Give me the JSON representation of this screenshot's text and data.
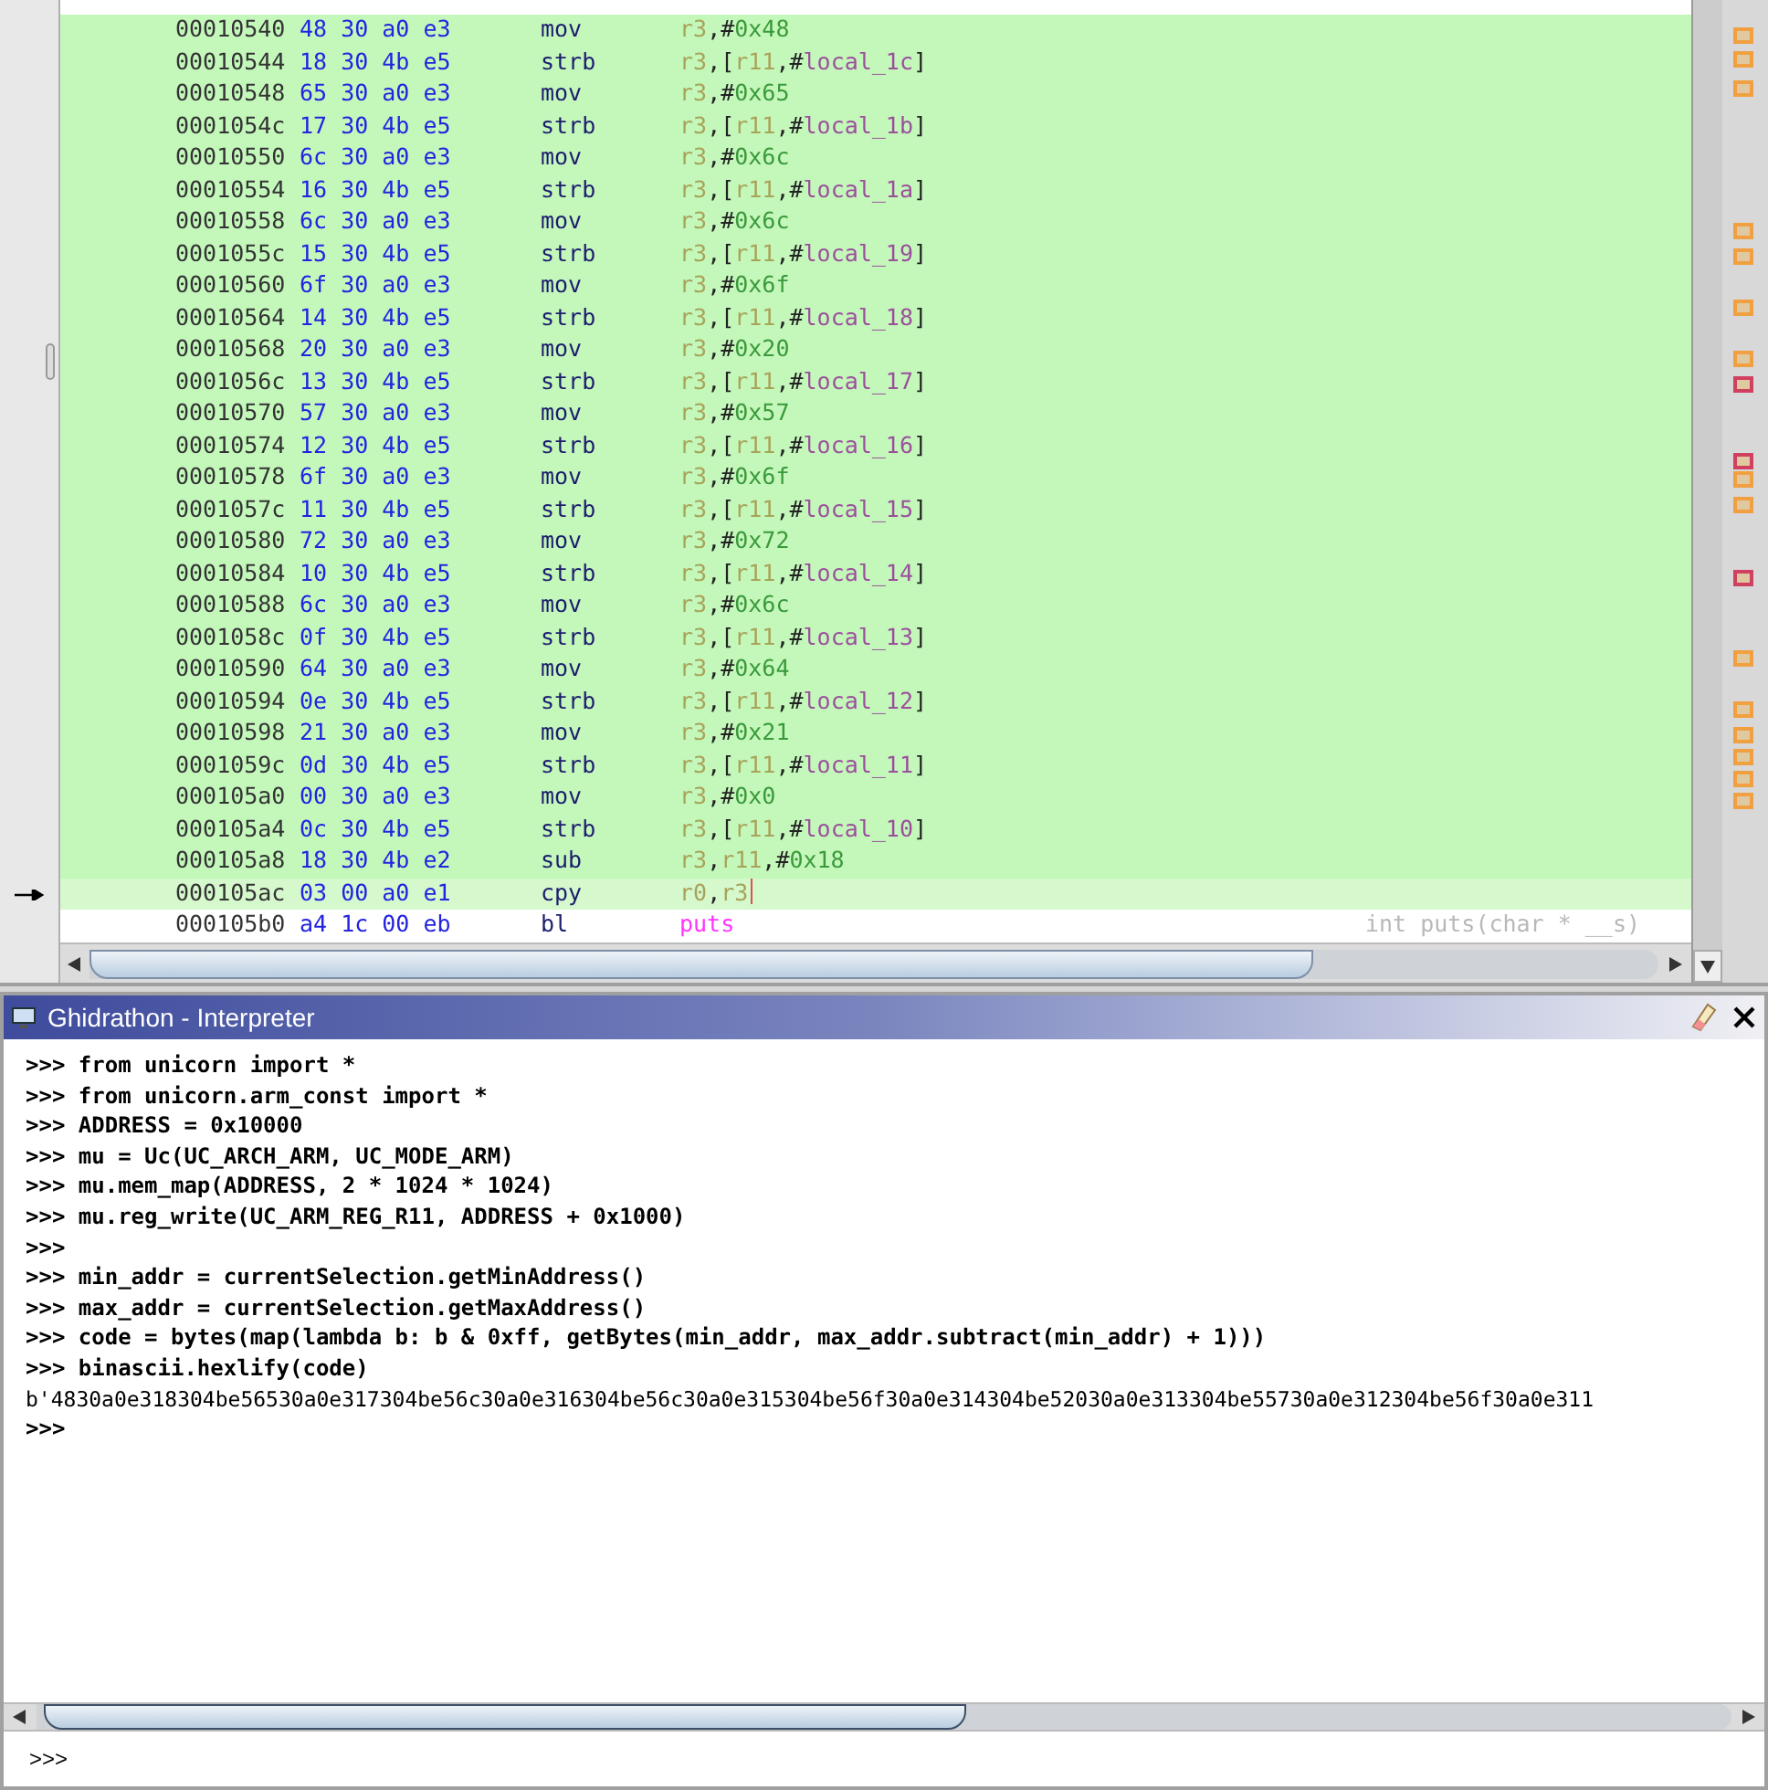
{
  "listing": {
    "rows": [
      {
        "address": "00010540",
        "bytes": "48 30 a0 e3",
        "mnemonic": "mov",
        "operands": [
          {
            "text": "r3",
            "kind": "register"
          },
          {
            "text": ",#",
            "kind": "punct"
          },
          {
            "text": "0x48",
            "kind": "scalar"
          }
        ],
        "in_selection": true,
        "cursor": false
      },
      {
        "address": "00010544",
        "bytes": "18 30 4b e5",
        "mnemonic": "strb",
        "operands": [
          {
            "text": "r3",
            "kind": "register"
          },
          {
            "text": ",[",
            "kind": "punct"
          },
          {
            "text": "r11",
            "kind": "register"
          },
          {
            "text": ",#",
            "kind": "punct"
          },
          {
            "text": "local_1c",
            "kind": "variable"
          },
          {
            "text": "]",
            "kind": "punct"
          }
        ],
        "in_selection": true,
        "cursor": false
      },
      {
        "address": "00010548",
        "bytes": "65 30 a0 e3",
        "mnemonic": "mov",
        "operands": [
          {
            "text": "r3",
            "kind": "register"
          },
          {
            "text": ",#",
            "kind": "punct"
          },
          {
            "text": "0x65",
            "kind": "scalar"
          }
        ],
        "in_selection": true,
        "cursor": false
      },
      {
        "address": "0001054c",
        "bytes": "17 30 4b e5",
        "mnemonic": "strb",
        "operands": [
          {
            "text": "r3",
            "kind": "register"
          },
          {
            "text": ",[",
            "kind": "punct"
          },
          {
            "text": "r11",
            "kind": "register"
          },
          {
            "text": ",#",
            "kind": "punct"
          },
          {
            "text": "local_1b",
            "kind": "variable"
          },
          {
            "text": "]",
            "kind": "punct"
          }
        ],
        "in_selection": true,
        "cursor": false
      },
      {
        "address": "00010550",
        "bytes": "6c 30 a0 e3",
        "mnemonic": "mov",
        "operands": [
          {
            "text": "r3",
            "kind": "register"
          },
          {
            "text": ",#",
            "kind": "punct"
          },
          {
            "text": "0x6c",
            "kind": "scalar"
          }
        ],
        "in_selection": true,
        "cursor": false
      },
      {
        "address": "00010554",
        "bytes": "16 30 4b e5",
        "mnemonic": "strb",
        "operands": [
          {
            "text": "r3",
            "kind": "register"
          },
          {
            "text": ",[",
            "kind": "punct"
          },
          {
            "text": "r11",
            "kind": "register"
          },
          {
            "text": ",#",
            "kind": "punct"
          },
          {
            "text": "local_1a",
            "kind": "variable"
          },
          {
            "text": "]",
            "kind": "punct"
          }
        ],
        "in_selection": true,
        "cursor": false
      },
      {
        "address": "00010558",
        "bytes": "6c 30 a0 e3",
        "mnemonic": "mov",
        "operands": [
          {
            "text": "r3",
            "kind": "register"
          },
          {
            "text": ",#",
            "kind": "punct"
          },
          {
            "text": "0x6c",
            "kind": "scalar"
          }
        ],
        "in_selection": true,
        "cursor": false
      },
      {
        "address": "0001055c",
        "bytes": "15 30 4b e5",
        "mnemonic": "strb",
        "operands": [
          {
            "text": "r3",
            "kind": "register"
          },
          {
            "text": ",[",
            "kind": "punct"
          },
          {
            "text": "r11",
            "kind": "register"
          },
          {
            "text": ",#",
            "kind": "punct"
          },
          {
            "text": "local_19",
            "kind": "variable"
          },
          {
            "text": "]",
            "kind": "punct"
          }
        ],
        "in_selection": true,
        "cursor": false
      },
      {
        "address": "00010560",
        "bytes": "6f 30 a0 e3",
        "mnemonic": "mov",
        "operands": [
          {
            "text": "r3",
            "kind": "register"
          },
          {
            "text": ",#",
            "kind": "punct"
          },
          {
            "text": "0x6f",
            "kind": "scalar"
          }
        ],
        "in_selection": true,
        "cursor": false
      },
      {
        "address": "00010564",
        "bytes": "14 30 4b e5",
        "mnemonic": "strb",
        "operands": [
          {
            "text": "r3",
            "kind": "register"
          },
          {
            "text": ",[",
            "kind": "punct"
          },
          {
            "text": "r11",
            "kind": "register"
          },
          {
            "text": ",#",
            "kind": "punct"
          },
          {
            "text": "local_18",
            "kind": "variable"
          },
          {
            "text": "]",
            "kind": "punct"
          }
        ],
        "in_selection": true,
        "cursor": false
      },
      {
        "address": "00010568",
        "bytes": "20 30 a0 e3",
        "mnemonic": "mov",
        "operands": [
          {
            "text": "r3",
            "kind": "register"
          },
          {
            "text": ",#",
            "kind": "punct"
          },
          {
            "text": "0x20",
            "kind": "scalar"
          }
        ],
        "in_selection": true,
        "cursor": false
      },
      {
        "address": "0001056c",
        "bytes": "13 30 4b e5",
        "mnemonic": "strb",
        "operands": [
          {
            "text": "r3",
            "kind": "register"
          },
          {
            "text": ",[",
            "kind": "punct"
          },
          {
            "text": "r11",
            "kind": "register"
          },
          {
            "text": ",#",
            "kind": "punct"
          },
          {
            "text": "local_17",
            "kind": "variable"
          },
          {
            "text": "]",
            "kind": "punct"
          }
        ],
        "in_selection": true,
        "cursor": false
      },
      {
        "address": "00010570",
        "bytes": "57 30 a0 e3",
        "mnemonic": "mov",
        "operands": [
          {
            "text": "r3",
            "kind": "register"
          },
          {
            "text": ",#",
            "kind": "punct"
          },
          {
            "text": "0x57",
            "kind": "scalar"
          }
        ],
        "in_selection": true,
        "cursor": false
      },
      {
        "address": "00010574",
        "bytes": "12 30 4b e5",
        "mnemonic": "strb",
        "operands": [
          {
            "text": "r3",
            "kind": "register"
          },
          {
            "text": ",[",
            "kind": "punct"
          },
          {
            "text": "r11",
            "kind": "register"
          },
          {
            "text": ",#",
            "kind": "punct"
          },
          {
            "text": "local_16",
            "kind": "variable"
          },
          {
            "text": "]",
            "kind": "punct"
          }
        ],
        "in_selection": true,
        "cursor": false
      },
      {
        "address": "00010578",
        "bytes": "6f 30 a0 e3",
        "mnemonic": "mov",
        "operands": [
          {
            "text": "r3",
            "kind": "register"
          },
          {
            "text": ",#",
            "kind": "punct"
          },
          {
            "text": "0x6f",
            "kind": "scalar"
          }
        ],
        "in_selection": true,
        "cursor": false
      },
      {
        "address": "0001057c",
        "bytes": "11 30 4b e5",
        "mnemonic": "strb",
        "operands": [
          {
            "text": "r3",
            "kind": "register"
          },
          {
            "text": ",[",
            "kind": "punct"
          },
          {
            "text": "r11",
            "kind": "register"
          },
          {
            "text": ",#",
            "kind": "punct"
          },
          {
            "text": "local_15",
            "kind": "variable"
          },
          {
            "text": "]",
            "kind": "punct"
          }
        ],
        "in_selection": true,
        "cursor": false
      },
      {
        "address": "00010580",
        "bytes": "72 30 a0 e3",
        "mnemonic": "mov",
        "operands": [
          {
            "text": "r3",
            "kind": "register"
          },
          {
            "text": ",#",
            "kind": "punct"
          },
          {
            "text": "0x72",
            "kind": "scalar"
          }
        ],
        "in_selection": true,
        "cursor": false
      },
      {
        "address": "00010584",
        "bytes": "10 30 4b e5",
        "mnemonic": "strb",
        "operands": [
          {
            "text": "r3",
            "kind": "register"
          },
          {
            "text": ",[",
            "kind": "punct"
          },
          {
            "text": "r11",
            "kind": "register"
          },
          {
            "text": ",#",
            "kind": "punct"
          },
          {
            "text": "local_14",
            "kind": "variable"
          },
          {
            "text": "]",
            "kind": "punct"
          }
        ],
        "in_selection": true,
        "cursor": false
      },
      {
        "address": "00010588",
        "bytes": "6c 30 a0 e3",
        "mnemonic": "mov",
        "operands": [
          {
            "text": "r3",
            "kind": "register"
          },
          {
            "text": ",#",
            "kind": "punct"
          },
          {
            "text": "0x6c",
            "kind": "scalar"
          }
        ],
        "in_selection": true,
        "cursor": false
      },
      {
        "address": "0001058c",
        "bytes": "0f 30 4b e5",
        "mnemonic": "strb",
        "operands": [
          {
            "text": "r3",
            "kind": "register"
          },
          {
            "text": ",[",
            "kind": "punct"
          },
          {
            "text": "r11",
            "kind": "register"
          },
          {
            "text": ",#",
            "kind": "punct"
          },
          {
            "text": "local_13",
            "kind": "variable"
          },
          {
            "text": "]",
            "kind": "punct"
          }
        ],
        "in_selection": true,
        "cursor": false
      },
      {
        "address": "00010590",
        "bytes": "64 30 a0 e3",
        "mnemonic": "mov",
        "operands": [
          {
            "text": "r3",
            "kind": "register"
          },
          {
            "text": ",#",
            "kind": "punct"
          },
          {
            "text": "0x64",
            "kind": "scalar"
          }
        ],
        "in_selection": true,
        "cursor": false
      },
      {
        "address": "00010594",
        "bytes": "0e 30 4b e5",
        "mnemonic": "strb",
        "operands": [
          {
            "text": "r3",
            "kind": "register"
          },
          {
            "text": ",[",
            "kind": "punct"
          },
          {
            "text": "r11",
            "kind": "register"
          },
          {
            "text": ",#",
            "kind": "punct"
          },
          {
            "text": "local_12",
            "kind": "variable"
          },
          {
            "text": "]",
            "kind": "punct"
          }
        ],
        "in_selection": true,
        "cursor": false
      },
      {
        "address": "00010598",
        "bytes": "21 30 a0 e3",
        "mnemonic": "mov",
        "operands": [
          {
            "text": "r3",
            "kind": "register"
          },
          {
            "text": ",#",
            "kind": "punct"
          },
          {
            "text": "0x21",
            "kind": "scalar"
          }
        ],
        "in_selection": true,
        "cursor": false
      },
      {
        "address": "0001059c",
        "bytes": "0d 30 4b e5",
        "mnemonic": "strb",
        "operands": [
          {
            "text": "r3",
            "kind": "register"
          },
          {
            "text": ",[",
            "kind": "punct"
          },
          {
            "text": "r11",
            "kind": "register"
          },
          {
            "text": ",#",
            "kind": "punct"
          },
          {
            "text": "local_11",
            "kind": "variable"
          },
          {
            "text": "]",
            "kind": "punct"
          }
        ],
        "in_selection": true,
        "cursor": false
      },
      {
        "address": "000105a0",
        "bytes": "00 30 a0 e3",
        "mnemonic": "mov",
        "operands": [
          {
            "text": "r3",
            "kind": "register"
          },
          {
            "text": ",#",
            "kind": "punct"
          },
          {
            "text": "0x0",
            "kind": "scalar"
          }
        ],
        "in_selection": true,
        "cursor": false
      },
      {
        "address": "000105a4",
        "bytes": "0c 30 4b e5",
        "mnemonic": "strb",
        "operands": [
          {
            "text": "r3",
            "kind": "register"
          },
          {
            "text": ",[",
            "kind": "punct"
          },
          {
            "text": "r11",
            "kind": "register"
          },
          {
            "text": ",#",
            "kind": "punct"
          },
          {
            "text": "local_10",
            "kind": "variable"
          },
          {
            "text": "]",
            "kind": "punct"
          }
        ],
        "in_selection": true,
        "cursor": false
      },
      {
        "address": "000105a8",
        "bytes": "18 30 4b e2",
        "mnemonic": "sub",
        "operands": [
          {
            "text": "r3",
            "kind": "register"
          },
          {
            "text": ",",
            "kind": "punct"
          },
          {
            "text": "r11",
            "kind": "register"
          },
          {
            "text": ",#",
            "kind": "punct"
          },
          {
            "text": "0x18",
            "kind": "scalar"
          }
        ],
        "in_selection": true,
        "cursor": false
      },
      {
        "address": "000105ac",
        "bytes": "03 00 a0 e1",
        "mnemonic": "cpy",
        "operands": [
          {
            "text": "r0",
            "kind": "register"
          },
          {
            "text": ",",
            "kind": "punct"
          },
          {
            "text": "r3",
            "kind": "register"
          }
        ],
        "in_selection": true,
        "cursor": true
      },
      {
        "address": "000105b0",
        "bytes": "a4 1c 00 eb",
        "mnemonic": "bl",
        "operands": [
          {
            "text": "puts",
            "kind": "function"
          }
        ],
        "comment": "int puts(char * __s)",
        "in_selection": false,
        "cursor": false
      }
    ]
  },
  "interpreter": {
    "title": "Ghidrathon - Interpreter",
    "lines": [
      {
        "text": ">>> from unicorn import *",
        "kind": "input"
      },
      {
        "text": ">>> from unicorn.arm_const import *",
        "kind": "input"
      },
      {
        "text": ">>> ADDRESS = 0x10000",
        "kind": "input"
      },
      {
        "text": ">>> mu = Uc(UC_ARCH_ARM, UC_MODE_ARM)",
        "kind": "input"
      },
      {
        "text": ">>> mu.mem_map(ADDRESS, 2 * 1024 * 1024)",
        "kind": "input"
      },
      {
        "text": ">>> mu.reg_write(UC_ARM_REG_R11, ADDRESS + 0x1000)",
        "kind": "input"
      },
      {
        "text": ">>>",
        "kind": "input"
      },
      {
        "text": ">>> min_addr = currentSelection.getMinAddress()",
        "kind": "input"
      },
      {
        "text": ">>> max_addr = currentSelection.getMaxAddress()",
        "kind": "input"
      },
      {
        "text": ">>> code = bytes(map(lambda b: b & 0xff, getBytes(min_addr, max_addr.subtract(min_addr) + 1)))",
        "kind": "input"
      },
      {
        "text": ">>> binascii.hexlify(code)",
        "kind": "input"
      },
      {
        "text": "b'4830a0e318304be56530a0e317304be56c30a0e316304be56c30a0e315304be56f30a0e314304be52030a0e313304be55730a0e312304be56f30a0e311",
        "kind": "output"
      },
      {
        "text": ">>>",
        "kind": "input"
      }
    ],
    "prompt": ">>>"
  }
}
